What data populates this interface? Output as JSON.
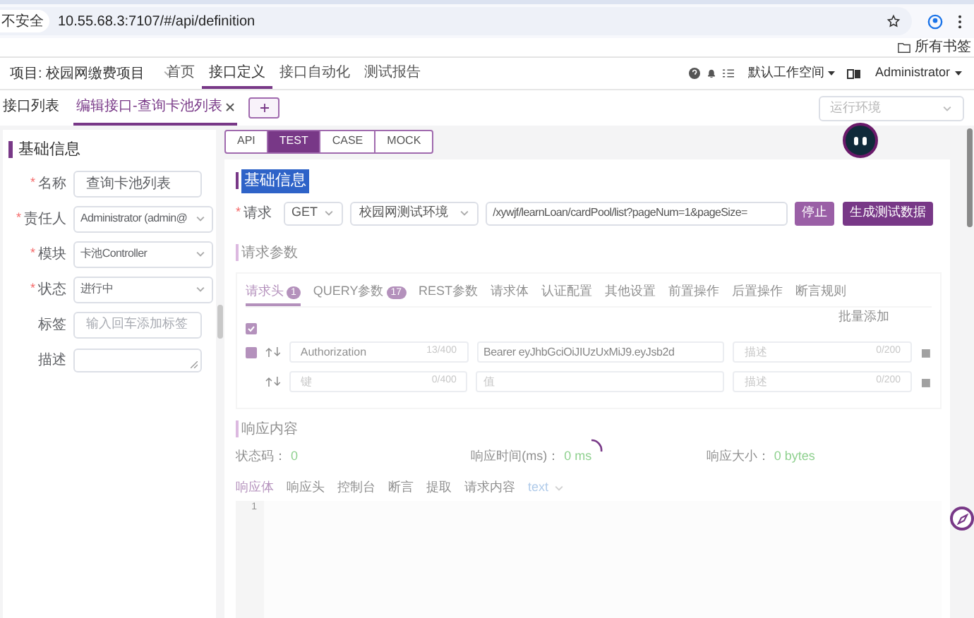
{
  "browser": {
    "security_label": "不安全",
    "url": "10.55.68.3:7107/#/api/definition",
    "bookmarks_label": "所有书签"
  },
  "header": {
    "project": "项目: 校园网缴费项目",
    "nav": [
      {
        "label": "首页",
        "selected": false
      },
      {
        "label": "接口定义",
        "selected": true
      },
      {
        "label": "接口自动化",
        "selected": false
      },
      {
        "label": "测试报告",
        "selected": false
      }
    ],
    "workspace": "默认工作空间",
    "user": "Administrator"
  },
  "tabs": [
    {
      "label": "接口列表",
      "selected": false,
      "closable": false
    },
    {
      "label": "编辑接口-查询卡池列表",
      "selected": true,
      "closable": true
    }
  ],
  "env_select": {
    "placeholder": "运行环境"
  },
  "required_mark": "*",
  "basic_info": {
    "title": "基础信息",
    "fields": [
      {
        "label": "名称",
        "required": true,
        "kind": "input",
        "value": "查询卡池列表"
      },
      {
        "label": "责任人",
        "required": true,
        "kind": "select",
        "value": "Administrator (admin@"
      },
      {
        "label": "模块",
        "required": true,
        "kind": "select",
        "value": "卡池Controller"
      },
      {
        "label": "状态",
        "required": true,
        "kind": "select",
        "value": "进行中"
      },
      {
        "label": "标签",
        "required": false,
        "kind": "input",
        "placeholder": "输入回车添加标签"
      },
      {
        "label": "描述",
        "required": false,
        "kind": "textarea"
      }
    ]
  },
  "mode_tabs": [
    {
      "label": "API",
      "selected": false
    },
    {
      "label": "TEST",
      "selected": true
    },
    {
      "label": "CASE",
      "selected": false
    },
    {
      "label": "MOCK",
      "selected": false
    }
  ],
  "request": {
    "section_title": "基础信息",
    "label": "请求",
    "required": true,
    "method": "GET",
    "environment": "校园网测试环境",
    "url": "/xywjf/learnLoan/cardPool/list?pageNum=1&pageSize=",
    "buttons": [
      {
        "label": "停止",
        "kind": "stop"
      },
      {
        "label": "生成测试数据",
        "kind": "primary"
      }
    ]
  },
  "loading": true,
  "params": {
    "title": "请求参数",
    "tabs": [
      {
        "label": "请求头",
        "count": "1",
        "selected": true
      },
      {
        "label": "QUERY参数",
        "count": "17",
        "selected": false
      },
      {
        "label": "REST参数",
        "selected": false
      },
      {
        "label": "请求体",
        "selected": false
      },
      {
        "label": "认证配置",
        "selected": false
      },
      {
        "label": "其他设置",
        "selected": false
      },
      {
        "label": "前置操作",
        "selected": false
      },
      {
        "label": "后置操作",
        "selected": false
      },
      {
        "label": "断言规则",
        "selected": false
      }
    ],
    "batch_add": "批量添加",
    "all_checked": true,
    "rows": [
      {
        "kind": "filled",
        "checked": true,
        "key": "Authorization",
        "key_count": "13/400",
        "value": "Bearer eyJhbGciOiJIUzUxMiJ9.eyJsb2d",
        "desc_placeholder": "描述",
        "desc_count": "0/200"
      },
      {
        "kind": "new",
        "key_placeholder": "键",
        "key_count": "0/400",
        "value_placeholder": "值",
        "desc_placeholder": "描述",
        "desc_count": "0/200"
      }
    ]
  },
  "response": {
    "title": "响应内容",
    "stats": [
      {
        "label": "状态码：",
        "value": "0"
      },
      {
        "label": "响应时间(ms)：",
        "value": "0 ms"
      },
      {
        "label": "响应大小：",
        "value": "0 bytes"
      }
    ],
    "tabs": [
      {
        "label": "响应体",
        "selected": true
      },
      {
        "label": "响应头",
        "selected": false
      },
      {
        "label": "控制台",
        "selected": false
      },
      {
        "label": "断言",
        "selected": false
      },
      {
        "label": "提取",
        "selected": false
      },
      {
        "label": "请求内容",
        "selected": false
      }
    ],
    "format": "text",
    "line_numbers": [
      "1"
    ]
  }
}
